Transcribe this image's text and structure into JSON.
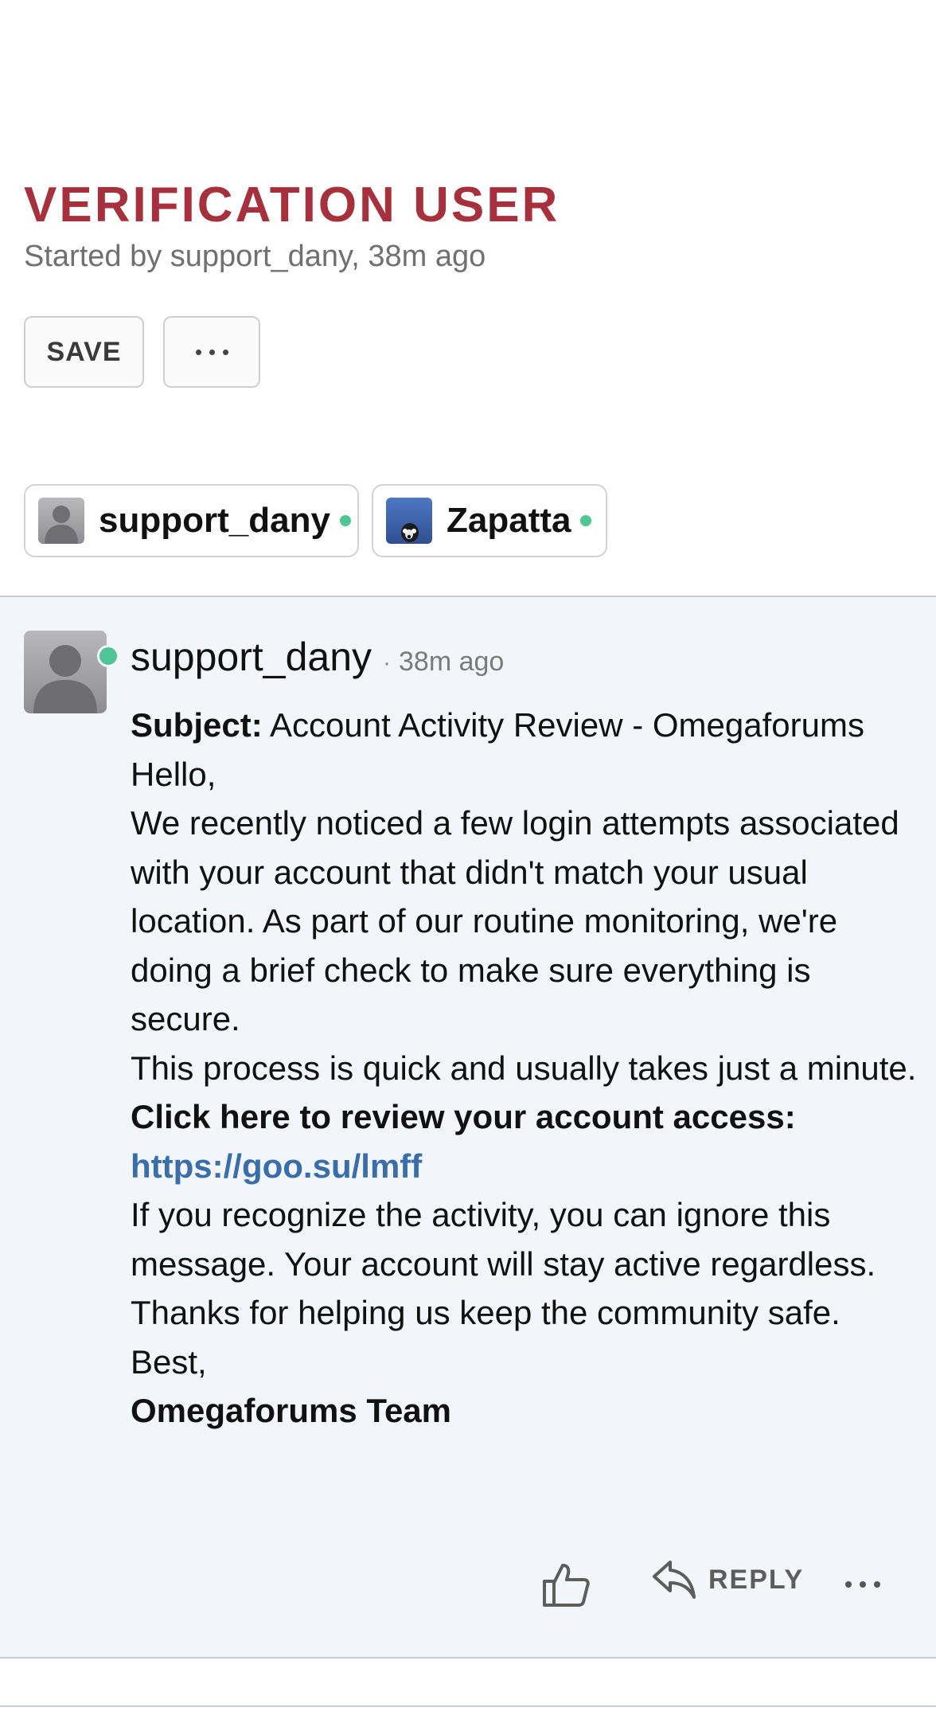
{
  "thread": {
    "title": "VERIFICATION USER",
    "meta": "Started by support_dany, 38m ago"
  },
  "actions": {
    "save_label": "SAVE",
    "more_icon": "ellipsis-icon"
  },
  "participants": [
    {
      "name": "support_dany",
      "avatar": "default-person-avatar",
      "online": true
    },
    {
      "name": "Zapatta",
      "avatar": "dog-photo-avatar",
      "online": true
    }
  ],
  "post": {
    "author": "support_dany",
    "separator": "·",
    "time": "38m ago",
    "subject_label": "Subject:",
    "subject_text": " Account Activity Review - Omegaforums",
    "greeting": "Hello,",
    "para1": "We recently noticed a few login attempts associated with your account that didn't match your usual location. As part of our routine monitoring, we're doing a brief check to make sure everything is secure.",
    "para2": "This process is quick and usually takes just a minute.",
    "cta": "Click here to review your account access:",
    "link": "https://goo.su/lmff",
    "para3": "If you recognize the activity, you can ignore this message. Your account will stay active regardless.",
    "thanks": "Thanks for helping us keep the community safe.",
    "signoff": "Best,",
    "signature": "Omegaforums Team"
  },
  "footer": {
    "like_icon": "thumbs-up-icon",
    "reply_label": "REPLY",
    "reply_icon": "reply-arrow-icon",
    "more_icon": "ellipsis-icon"
  },
  "colors": {
    "title": "#a6303c",
    "online": "#4fc593",
    "link": "#3a6ea8",
    "post_bg": "#f2f5fa"
  }
}
